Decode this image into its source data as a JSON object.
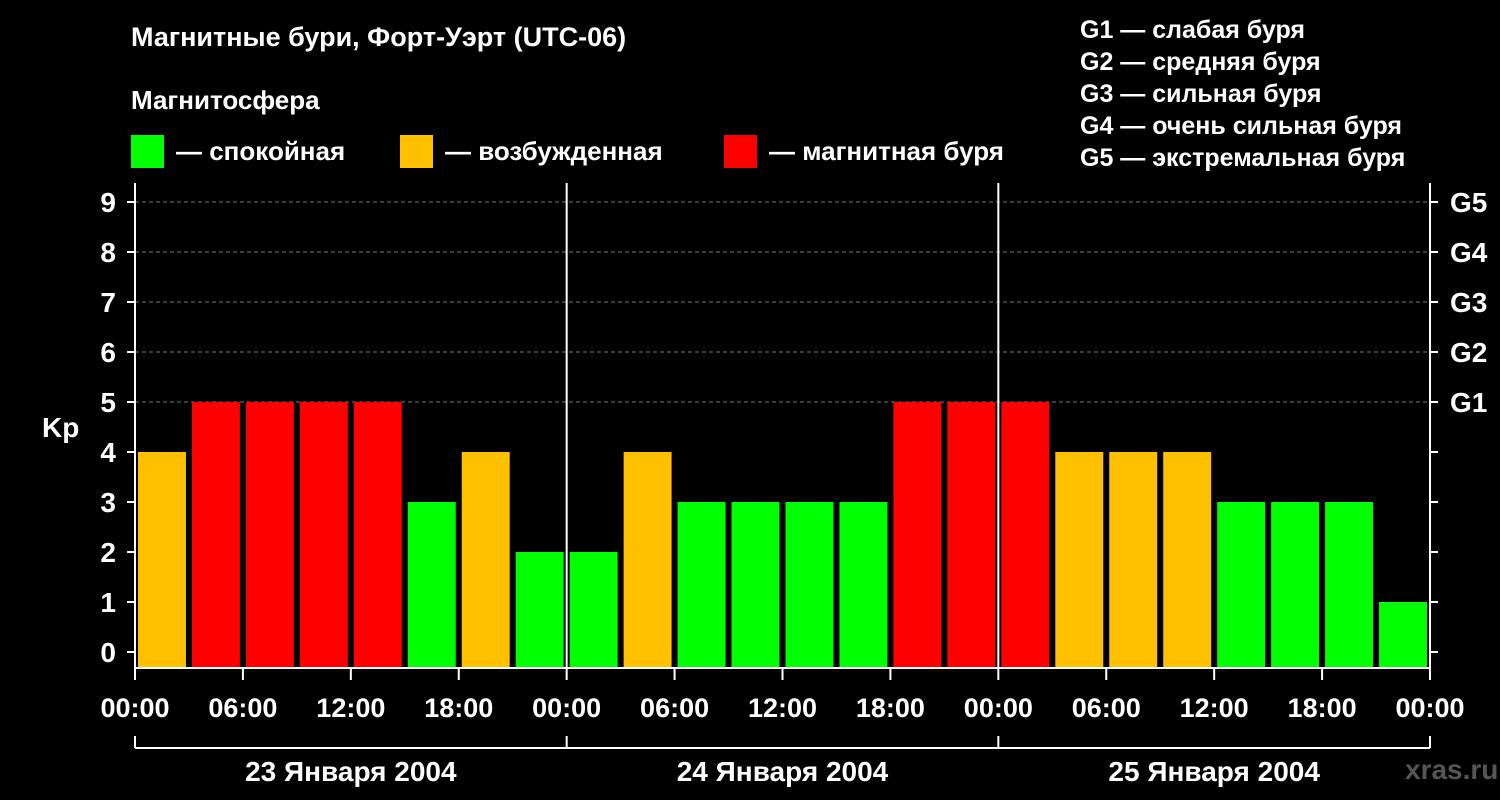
{
  "header": {
    "title": "Магнитные бури, Форт-Уэрт (UTC-06)",
    "subtitle": "Магнитосфера"
  },
  "legend": [
    {
      "label": "— спокойная",
      "color": "#00ff00"
    },
    {
      "label": "— возбужденная",
      "color": "#ffc000"
    },
    {
      "label": "— магнитная буря",
      "color": "#ff0000"
    }
  ],
  "g_legend": [
    "G1 — слабая буря",
    "G2 — средняя буря",
    "G3 — сильная буря",
    "G4 — очень сильная буря",
    "G5 — экстремальная буря"
  ],
  "watermark": "xras.ru",
  "chart_data": {
    "type": "bar",
    "ylabel": "Kp",
    "ylim": [
      0,
      9
    ],
    "y_ticks": [
      "0",
      "1",
      "2",
      "3",
      "4",
      "5",
      "6",
      "7",
      "8",
      "9"
    ],
    "right_ticks": [
      {
        "kp": 5,
        "label": "G1"
      },
      {
        "kp": 6,
        "label": "G2"
      },
      {
        "kp": 7,
        "label": "G3"
      },
      {
        "kp": 8,
        "label": "G4"
      },
      {
        "kp": 9,
        "label": "G5"
      }
    ],
    "x_tick_labels": [
      "00:00",
      "06:00",
      "12:00",
      "18:00",
      "00:00",
      "06:00",
      "12:00",
      "18:00",
      "00:00",
      "06:00",
      "12:00",
      "18:00",
      "00:00"
    ],
    "days": [
      "23 Января 2004",
      "24 Января 2004",
      "25 Января 2004"
    ],
    "interval_hours": 3,
    "values": [
      4,
      5,
      5,
      5,
      5,
      3,
      4,
      2,
      2,
      4,
      3,
      3,
      3,
      3,
      5,
      5,
      5,
      4,
      4,
      4,
      3,
      3,
      3,
      1
    ],
    "colors": {
      "quiet": "#00ff00",
      "active": "#ffc000",
      "storm": "#ff0000"
    },
    "grid": true
  }
}
